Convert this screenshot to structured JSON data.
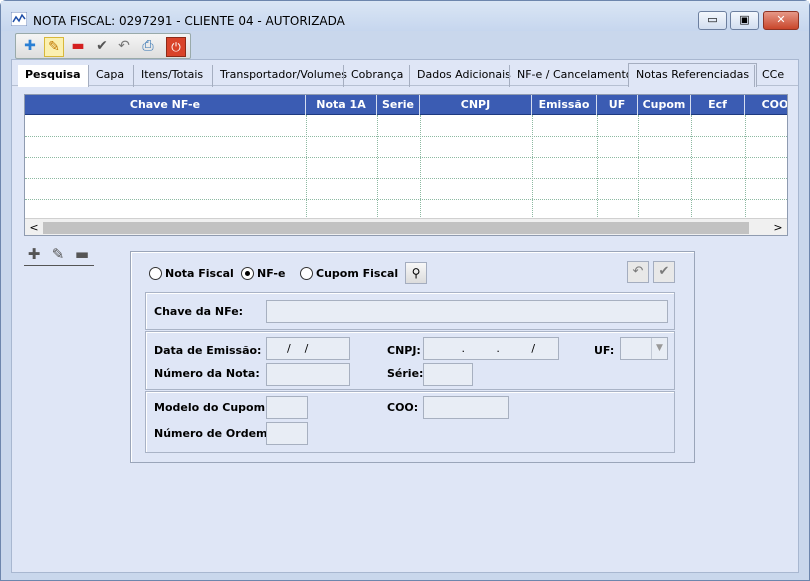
{
  "window": {
    "title": "NOTA FISCAL: 0297291 - CLIENTE 04 - AUTORIZADA",
    "min_label": "▭",
    "max_label": "▣",
    "close_label": "✕"
  },
  "toolbar": {
    "add_icon": "✚",
    "edit_icon": "✎",
    "remove_icon": "▬",
    "confirm_icon": "✔",
    "undo_icon": "↶",
    "print_icon": "⎙",
    "exit_icon": "⏻"
  },
  "tabs": [
    {
      "label": "Pesquisa"
    },
    {
      "label": "Capa"
    },
    {
      "label": "Itens/Totais"
    },
    {
      "label": "Transportador/Volumes"
    },
    {
      "label": "Cobrança"
    },
    {
      "label": "Dados Adicionais"
    },
    {
      "label": "NF-e / Cancelamento"
    },
    {
      "label": "Notas Referenciadas"
    },
    {
      "label": "CCe"
    }
  ],
  "grid": {
    "columns": [
      "Chave NF-e",
      "Nota 1A",
      "Serie",
      "CNPJ",
      "Emissão",
      "UF",
      "Cupom",
      "Ecf",
      "COO"
    ],
    "rows": [],
    "scroll_left": "<",
    "scroll_right": ">"
  },
  "row_tools": {
    "add": "✚",
    "edit": "✎",
    "remove": "▬"
  },
  "form": {
    "radio_nota_fiscal": "Nota Fiscal",
    "radio_nfe": "NF-e",
    "radio_cupom_fiscal": "Cupom Fiscal",
    "selected_radio": "NF-e",
    "search_icon": "⚲",
    "undo_icon": "↶",
    "confirm_icon": "✔",
    "chave_label": "Chave da NFe:",
    "chave_value": "",
    "data_emissao_label": "Data de Emissão:",
    "data_emissao_value": "    /    /",
    "numero_nota_label": "Número da Nota:",
    "numero_nota_value": "",
    "cnpj_label": "CNPJ:",
    "cnpj_value": "         .         .         /          –",
    "serie_label": "Série:",
    "serie_value": "",
    "uf_label": "UF:",
    "uf_value": "",
    "modelo_cupom_label": "Modelo do Cupom:",
    "modelo_cupom_value": "",
    "numero_ordem_label": "Número de Ordem:",
    "numero_ordem_value": "",
    "coo_label": "COO:",
    "coo_value": ""
  },
  "colors": {
    "grid_header": "#3b5cb3",
    "close_button": "#c9462b",
    "panel": "#dfe6f6"
  }
}
